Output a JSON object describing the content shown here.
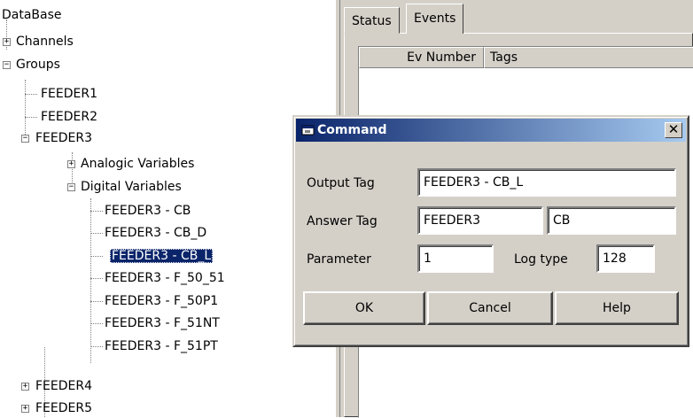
{
  "tree": {
    "root": "DataBase",
    "channels": "Channels",
    "groups": "Groups",
    "feeder1": "FEEDER1",
    "feeder2": "FEEDER2",
    "feeder3": "FEEDER3",
    "analogic": "Analogic Variables",
    "digital": "Digital Variables",
    "digital_items": [
      "FEEDER3 - CB",
      "FEEDER3 - CB_D",
      "FEEDER3 - CB_L",
      "FEEDER3 - F_50_51",
      "FEEDER3 - F_50P1",
      "FEEDER3 - F_51NT",
      "FEEDER3 - F_51PT"
    ],
    "selected_item": "FEEDER3 - CB_L",
    "feeder4": "FEEDER4",
    "feeder5": "FEEDER5"
  },
  "tabs": {
    "status": "Status",
    "events": "Events"
  },
  "events_list": {
    "col_ev_number": "Ev Number",
    "col_tags": "Tags"
  },
  "dialog": {
    "title": "Command",
    "close_glyph": "✕",
    "output_tag_label": "Output Tag",
    "output_tag_value": "FEEDER3 - CB_L",
    "answer_tag_label": "Answer Tag",
    "answer_tag_value1": "FEEDER3",
    "answer_tag_value2": "CB",
    "parameter_label": "Parameter",
    "parameter_value": "1",
    "log_type_label": "Log type",
    "log_type_value": "128",
    "ok_label": "OK",
    "cancel_label": "Cancel",
    "help_label": "Help"
  },
  "icons": {
    "title_icon": "window-app-icon",
    "close_icon": "close-icon"
  },
  "colors": {
    "selection": "#0a246a",
    "title_gradient_start": "#0a246a",
    "title_gradient_end": "#a6caf0",
    "face": "#d4d0c8"
  }
}
